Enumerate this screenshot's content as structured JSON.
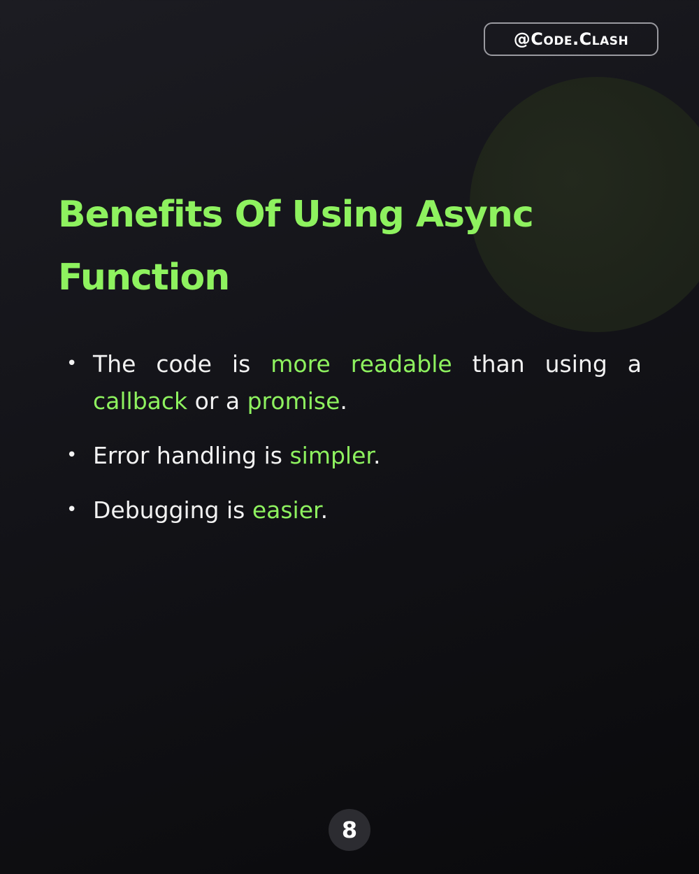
{
  "handle": "@Code.Clash",
  "title": {
    "line1": "Benefits Of Using Async",
    "line2": "Function"
  },
  "bullets": [
    {
      "segments": [
        "The code is ",
        "more readable",
        " than using a ",
        "callback",
        " or a ",
        "promise",
        "."
      ]
    },
    {
      "segments": [
        "Error handling is ",
        "simpler",
        "."
      ]
    },
    {
      "segments": [
        "Debugging is ",
        "easier",
        "."
      ]
    }
  ],
  "page_number": "8",
  "colors": {
    "accent": "#8ef25f",
    "text": "#f2f2f2",
    "background": "#131318"
  }
}
